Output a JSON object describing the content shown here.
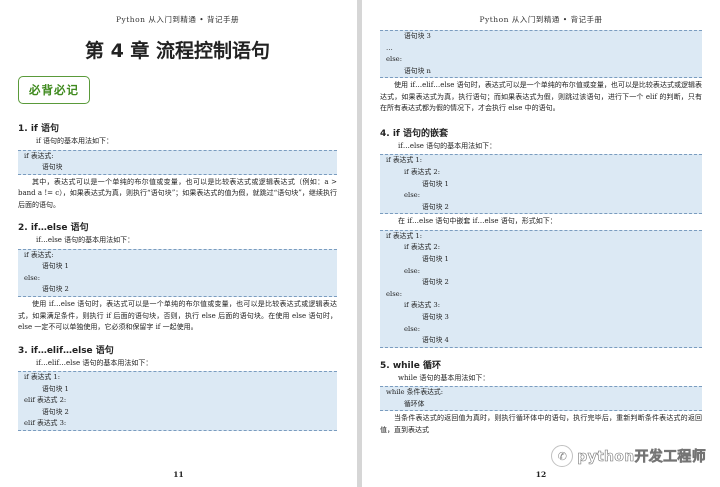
{
  "running_head": "Python 从入门到精通 • 背记手册",
  "left": {
    "chapter_title": "第 4 章 流程控制语句",
    "badge": "必背必记",
    "page_number": "11",
    "s1_heading": "1. if 语句",
    "s1_intro": "if 语句的基本用法如下：",
    "s1_code": [
      "if 表达式:",
      "语句块"
    ],
    "s1_text": "其中，表达式可以是一个单纯的布尔值或变量，也可以是比较表达式或逻辑表达式（例如：a > band a != c），如果表达式为真，则执行“语句块”；如果表达式的值为假，就跳过“语句块”，继续执行后面的语句。",
    "s2_heading": "2. if…else 语句",
    "s2_intro": "if…else 语句的基本用法如下：",
    "s2_code": [
      "if 表达式:",
      "语句块 1",
      "else:",
      "语句块 2"
    ],
    "s2_text": "使用 if…else 语句时，表达式可以是一个单纯的布尔值或变量，也可以是比较表达式或逻辑表达式，如果满足条件，则执行 if 后面的语句块，否则，执行 else 后面的语句块。在使用 else 语句时，else 一定不可以单独使用，它必须和保留字 if 一起使用。",
    "s3_heading": "3. if…elif…else 语句",
    "s3_intro": "if…elif…else 语句的基本用法如下：",
    "s3_code": [
      "if 表达式 1:",
      "语句块 1",
      "elif 表达式 2:",
      "语句块 2",
      "elif 表达式 3:"
    ]
  },
  "right": {
    "page_number": "12",
    "top_code": [
      "语句块 3",
      "…",
      "else:",
      "语句块 n"
    ],
    "top_text": "使用 if…elif…else 语句时，表达式可以是一个单纯的布尔值或变量，也可以是比较表达式或逻辑表达式，如果表达式为真，执行语句；而如果表达式为假，则跳过该语句，进行下一个 elif 的判断，只有在所有表达式都为假的情况下，才会执行 else 中的语句。",
    "s4_heading": "4. if 语句的嵌套",
    "s4_intro": "if…else 语句的基本用法如下：",
    "s4_code1": [
      "if 表达式 1:",
      "if 表达式 2:",
      "语句块 1",
      "else:",
      "语句块 2"
    ],
    "s4_mid": "在 if…else 语句中嵌套 if…else 语句，形式如下：",
    "s4_code2": [
      "if 表达式 1:",
      "if 表达式 2:",
      "语句块 1",
      "else:",
      "语句块 2",
      "else:",
      "if 表达式 3:",
      "语句块 3",
      "else:",
      "语句块 4"
    ],
    "s5_heading": "5. while 循环",
    "s5_intro": "while 语句的基本用法如下：",
    "s5_code": [
      "while 条件表达式:",
      "循环体"
    ],
    "s5_text": "当条件表达式的返回值为真时，则执行循环体中的语句，执行完毕后，重新判断条件表达式的返回值，直到表达式"
  },
  "watermark": {
    "text": "python开发工程师",
    "icon": "wechat-logo-icon"
  }
}
